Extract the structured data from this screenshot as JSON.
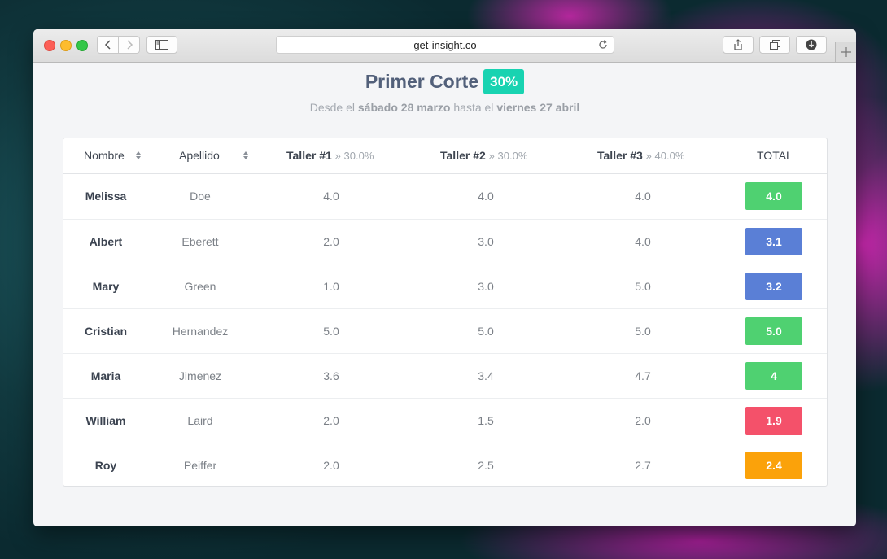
{
  "browser": {
    "url": "get-insight.co"
  },
  "page": {
    "title": "Primer Corte",
    "percent": "30%",
    "subtitle": {
      "pre": "Desde el ",
      "start": "sábado 28 marzo",
      "mid": " hasta el ",
      "end": "viernes 27 abril"
    }
  },
  "table": {
    "headers": {
      "name": "Nombre",
      "last": "Apellido",
      "t1": "Taller #1",
      "t1_weight": "» 30.0%",
      "t2": "Taller #2",
      "t2_weight": "» 30.0%",
      "t3": "Taller #3",
      "t3_weight": "» 40.0%",
      "total": "TOTAL"
    },
    "rows": [
      {
        "name": "Melissa",
        "last": "Doe",
        "t1": "4.0",
        "t2": "4.0",
        "t3": "4.0",
        "total": "4.0",
        "color": "#4fd171"
      },
      {
        "name": "Albert",
        "last": "Eberett",
        "t1": "2.0",
        "t2": "3.0",
        "t3": "4.0",
        "total": "3.1",
        "color": "#5a7fd6"
      },
      {
        "name": "Mary",
        "last": "Green",
        "t1": "1.0",
        "t2": "3.0",
        "t3": "5.0",
        "total": "3.2",
        "color": "#5a7fd6"
      },
      {
        "name": "Cristian",
        "last": "Hernandez",
        "t1": "5.0",
        "t2": "5.0",
        "t3": "5.0",
        "total": "5.0",
        "color": "#4fd171"
      },
      {
        "name": "Maria",
        "last": "Jimenez",
        "t1": "3.6",
        "t2": "3.4",
        "t3": "4.7",
        "total": "4",
        "color": "#4fd171"
      },
      {
        "name": "William",
        "last": "Laird",
        "t1": "2.0",
        "t2": "1.5",
        "t3": "2.0",
        "total": "1.9",
        "color": "#f4516a"
      },
      {
        "name": "Roy",
        "last": "Peiffer",
        "t1": "2.0",
        "t2": "2.5",
        "t3": "2.7",
        "total": "2.4",
        "color": "#fba20a"
      }
    ]
  },
  "colors": {
    "accent": "#18d3b1",
    "title": "#52607a"
  }
}
